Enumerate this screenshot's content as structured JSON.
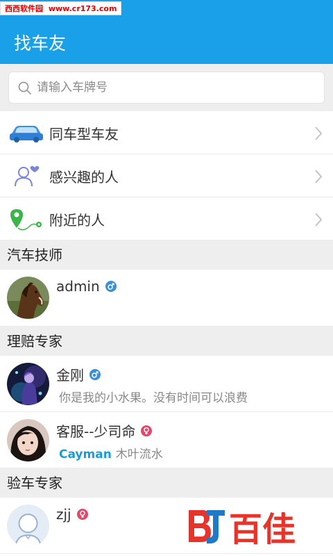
{
  "watermark": {
    "site_name": "西西软件园",
    "url": "www.cr173.com"
  },
  "header": {
    "title": "找车友"
  },
  "search": {
    "placeholder": "请输入车牌号",
    "value": ""
  },
  "menu": [
    {
      "label": "同车型车友",
      "icon": "car-icon"
    },
    {
      "label": "感兴趣的人",
      "icon": "person-heart-icon"
    },
    {
      "label": "附近的人",
      "icon": "location-pin-icon"
    }
  ],
  "sections": [
    {
      "title": "汽车技师",
      "contacts": [
        {
          "name": "admin",
          "gender": "male",
          "sub": "",
          "avatar": "horse-avatar"
        }
      ]
    },
    {
      "title": "理赔专家",
      "contacts": [
        {
          "name": "金刚",
          "gender": "male",
          "sub": "你是我的小水果。没有时间可以浪费",
          "avatar": "fantasy-avatar"
        },
        {
          "name": "客服--少司命",
          "gender": "female",
          "car": "Cayman",
          "sub": "木叶流水",
          "avatar": "girl-avatar"
        }
      ]
    },
    {
      "title": "验车专家",
      "contacts": [
        {
          "name": "zjj",
          "gender": "female",
          "sub": "",
          "avatar": "default-avatar"
        }
      ]
    }
  ],
  "brand_watermark": {
    "text": "百佳"
  },
  "colors": {
    "accent": "#1aa0e8",
    "male": "#3a8fd6",
    "female": "#e04a6a",
    "section_bg": "#eeeeee",
    "car_name": "#1a9ad8"
  }
}
